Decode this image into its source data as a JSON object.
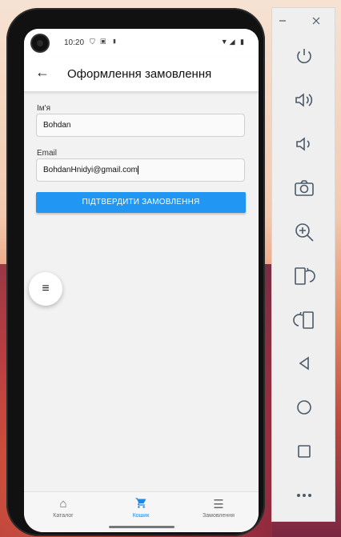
{
  "status_bar": {
    "time": "10:20"
  },
  "app_bar": {
    "title": "Оформлення замовлення"
  },
  "form": {
    "name_label": "Ім'я",
    "name_value": "Bohdan",
    "email_label": "Email",
    "email_value": "BohdanHnidyi@gmail.com",
    "submit_label": "ПІДТВЕРДИТИ ЗАМОВЛЕННЯ"
  },
  "bottom_nav": {
    "items": [
      {
        "label": "Каталог",
        "icon": "home-icon",
        "active": false
      },
      {
        "label": "Кошик",
        "icon": "cart-icon",
        "active": true
      },
      {
        "label": "Замовлення",
        "icon": "list-icon",
        "active": false
      }
    ]
  },
  "emulator_panel": {
    "buttons": [
      "minimize-icon",
      "close-icon",
      "power-icon",
      "volume-up-icon",
      "volume-down-icon",
      "camera-icon",
      "zoom-icon",
      "rotate-left-icon",
      "rotate-right-icon",
      "back-icon",
      "home-circle-icon",
      "overview-square-icon",
      "more-icon"
    ]
  },
  "colors": {
    "accent": "#2196f3",
    "active_nav": "#1e88e5"
  }
}
